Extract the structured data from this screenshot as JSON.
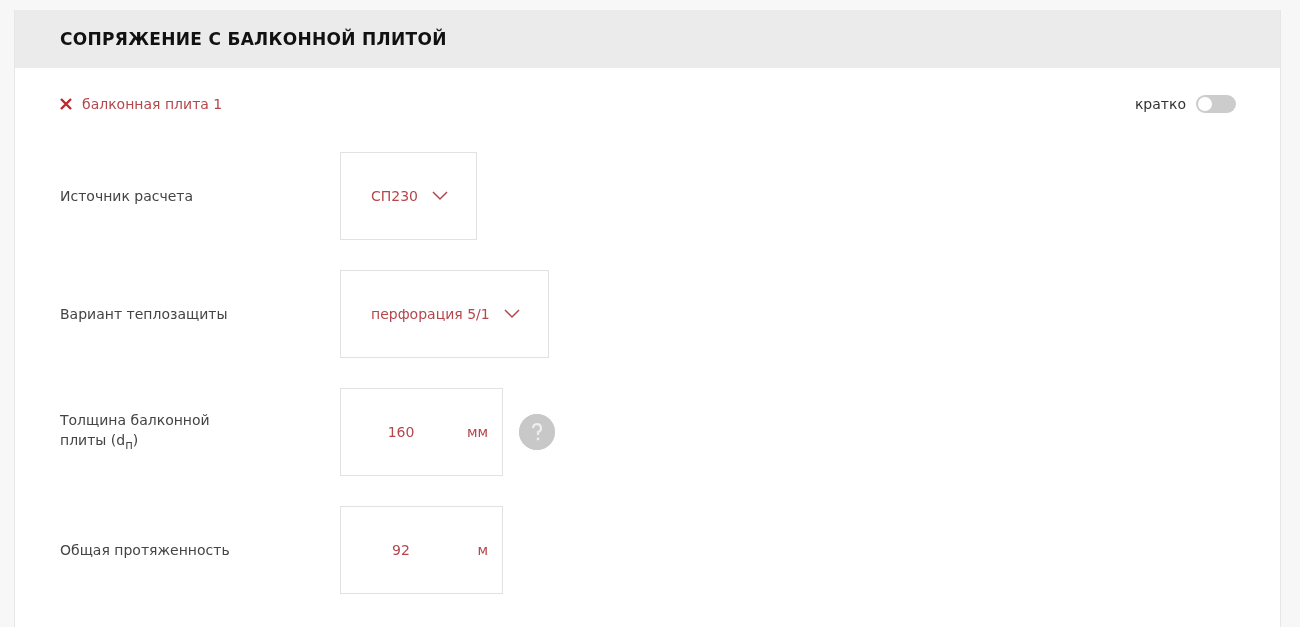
{
  "section": {
    "title": "СОПРЯЖЕНИЕ С БАЛКОННОЙ ПЛИТОЙ"
  },
  "item": {
    "label": "балконная плита 1"
  },
  "toggle": {
    "label": "кратко",
    "on": false
  },
  "fields": [
    {
      "kind": "select",
      "label": "Источник расчета",
      "value": "СП230"
    },
    {
      "kind": "select",
      "label": "Вариант теплозащиты",
      "value": "перфорация 5/1"
    },
    {
      "kind": "input",
      "label": "Толщина балконной плиты (d$_{п}$)",
      "value": "160",
      "unit": "мм",
      "help": true
    },
    {
      "kind": "input",
      "label": "Общая протяженность",
      "value": "92",
      "unit": "м",
      "help": false
    }
  ]
}
